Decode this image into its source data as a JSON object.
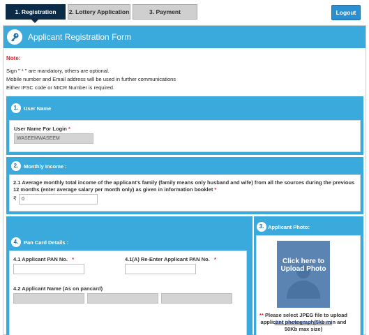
{
  "tabs": [
    {
      "label": "1. Registration"
    },
    {
      "label": "2. Lottery Application"
    },
    {
      "label": "3. Payment"
    }
  ],
  "logout_label": "Logout",
  "form": {
    "title": "Applicant Registration Form"
  },
  "notes": {
    "title": "Note:",
    "lines": [
      "Sign \" * \" are mandatory, others are optional.",
      "Mobile number and Email address will be used in further communications",
      "Either IFSC code or MICR Number is required."
    ]
  },
  "sections": {
    "user_name": {
      "number": "1.",
      "title": "User Name",
      "login_label": "User Name For Login",
      "login_value": "WASEEMWASEEM"
    },
    "monthly_income": {
      "number": "2.",
      "title": "Monthly Income :",
      "question": "2.1 Average monthly total income of the applicant's family (family means only husband and wife) from all the sources during the previous 12 months (enter average salary per month only) as given in information booklet",
      "currency": "₹",
      "value": "0"
    },
    "applicant_photo": {
      "number": "3.",
      "title": "Applicant Photo:",
      "upload_text": "Click here to Upload Photo",
      "instruction": "Please select JPEG file to upload applicant photograph(5kb min and 50Kb max size)",
      "reduce_link": "Click here to reduce photo size"
    },
    "pan_card": {
      "number": "4.",
      "title": "Pan Card Details :",
      "pan_label": "4.1 Applicant PAN No.",
      "pan_value": "",
      "reenter_label": "4.1(A) Re-Enter Applicant PAN No.",
      "reenter_value": "",
      "name_label": "4.2 Applicant Name (As on pancard)"
    }
  },
  "required_marker": "*",
  "colors": {
    "accent": "#3aa9db",
    "active_tab": "#0c2b47",
    "required": "#e0202a"
  }
}
